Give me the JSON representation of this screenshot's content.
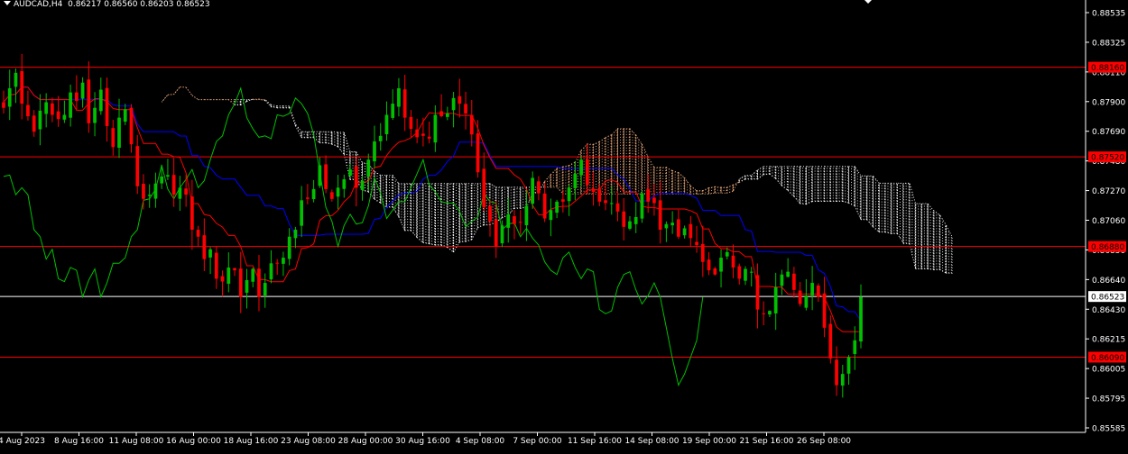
{
  "header": {
    "symbol": "AUDCAD,H4",
    "ohlc": "0.86217 0.86560 0.86203 0.86523"
  },
  "colors": {
    "background": "#000000",
    "bull": "#00c000",
    "bear": "#ff0000",
    "kijun": "#0000ff",
    "tenkan": "#ff0000",
    "chikou": "#00c000",
    "cloud_bull": "#f4b183",
    "cloud_bear": "#ffffff",
    "hline": "#ff0000",
    "price_line": "#ffffff",
    "axis": "#ffffff"
  },
  "chart_data": {
    "type": "candlestick",
    "ylim": [
      0.85585,
      0.8855
    ],
    "y_ticks": [
      "0.88535",
      "0.88325",
      "0.88110",
      "0.87900",
      "0.87690",
      "0.87480",
      "0.87270",
      "0.87060",
      "0.86850",
      "0.86640",
      "0.86430",
      "0.86215",
      "0.86005",
      "0.85795",
      "0.85585"
    ],
    "x_ticks": [
      "4 Aug 2023",
      "8 Aug 16:00",
      "11 Aug 08:00",
      "16 Aug 00:00",
      "18 Aug 16:00",
      "23 Aug 08:00",
      "28 Aug 00:00",
      "30 Aug 16:00",
      "4 Sep 08:00",
      "7 Sep 00:00",
      "11 Sep 16:00",
      "14 Sep 08:00",
      "19 Sep 00:00",
      "21 Sep 16:00",
      "26 Sep 08:00"
    ],
    "horizontal_levels": [
      {
        "value": 0.8816,
        "label": "0.88160"
      },
      {
        "value": 0.8752,
        "label": "0.87520"
      },
      {
        "value": 0.8688,
        "label": "0.86880"
      },
      {
        "value": 0.8609,
        "label": "0.86090"
      }
    ],
    "current_price": {
      "value": 0.86523,
      "label": "0.86523"
    },
    "close": [
      0.8787,
      0.8801,
      0.8812,
      0.879,
      0.8781,
      0.877,
      0.8785,
      0.8791,
      0.8782,
      0.8779,
      0.8782,
      0.8798,
      0.8792,
      0.8805,
      0.8776,
      0.8787,
      0.88,
      0.8774,
      0.8759,
      0.878,
      0.8786,
      0.8761,
      0.8731,
      0.8722,
      0.8725,
      0.8733,
      0.8738,
      0.8739,
      0.8725,
      0.873,
      0.8725,
      0.87,
      0.8695,
      0.8679,
      0.8686,
      0.8665,
      0.8663,
      0.8673,
      0.8671,
      0.8652,
      0.8664,
      0.8672,
      0.8652,
      0.8662,
      0.8676,
      0.8676,
      0.868,
      0.8695,
      0.87,
      0.8721,
      0.8722,
      0.8729,
      0.8746,
      0.8729,
      0.8722,
      0.873,
      0.8736,
      0.8743,
      0.873,
      0.8735,
      0.875,
      0.8763,
      0.8767,
      0.8782,
      0.879,
      0.8801,
      0.878,
      0.8772,
      0.8766,
      0.8767,
      0.8765,
      0.8782,
      0.8781,
      0.8783,
      0.8794,
      0.879,
      0.8783,
      0.8768,
      0.8741,
      0.8716,
      0.8706,
      0.8688,
      0.8703,
      0.8711,
      0.8704,
      0.8705,
      0.8717,
      0.8737,
      0.8726,
      0.8708,
      0.8714,
      0.872,
      0.872,
      0.873,
      0.874,
      0.875,
      0.8732,
      0.8727,
      0.872,
      0.8719,
      0.8719,
      0.8713,
      0.8702,
      0.8706,
      0.8709,
      0.8726,
      0.872,
      0.8719,
      0.87,
      0.8704,
      0.8705,
      0.8695,
      0.8701,
      0.8694,
      0.8689,
      0.8677,
      0.8671,
      0.8668,
      0.868,
      0.8684,
      0.8673,
      0.8665,
      0.8672,
      0.867,
      0.8643,
      0.864,
      0.8642,
      0.8659,
      0.8668,
      0.867,
      0.8657,
      0.8647,
      0.8653,
      0.8662,
      0.8652,
      0.863,
      0.8608,
      0.8589,
      0.8597,
      0.8609,
      0.8621,
      0.8652
    ]
  }
}
